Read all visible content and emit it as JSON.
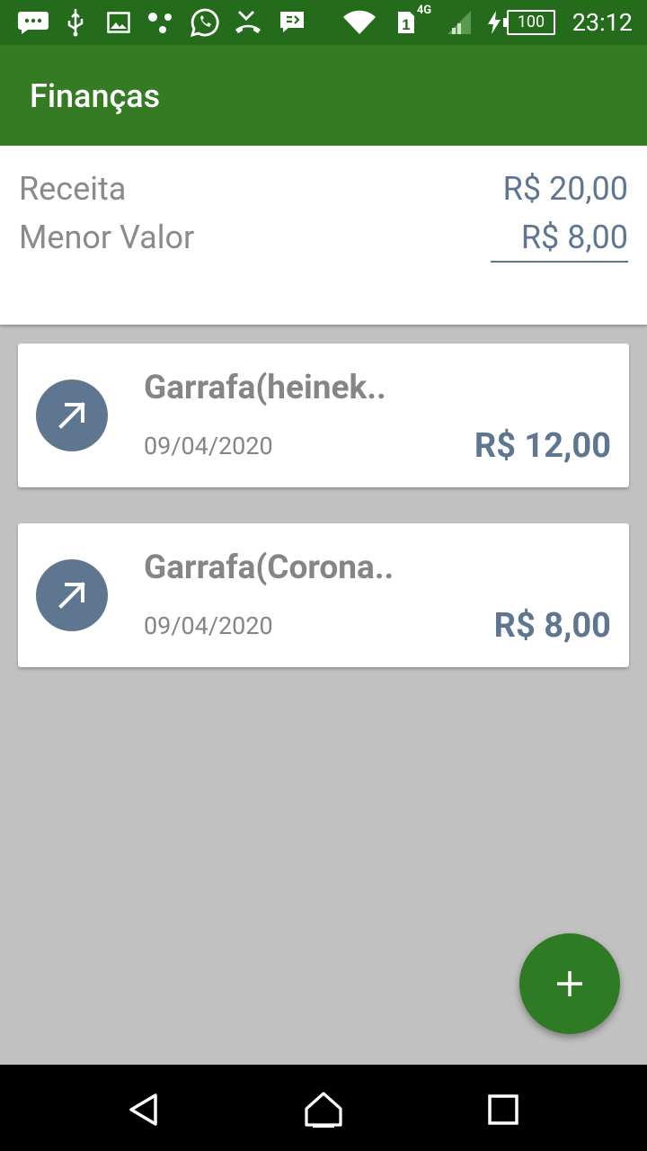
{
  "status_bar": {
    "time": "23:12",
    "battery_level": "100",
    "sim_slot": "1",
    "network_type": "4G",
    "icons": [
      "messages-icon",
      "usb-icon",
      "image-icon",
      "dots-icon",
      "whatsapp-icon",
      "missed-call-icon",
      "chat-icon",
      "wifi-icon",
      "sim-icon",
      "signal-icon",
      "charging-icon",
      "battery-icon"
    ]
  },
  "app_bar": {
    "title": "Finanças"
  },
  "summary": {
    "revenue_label": "Receita",
    "revenue_value": "R$ 20,00",
    "lowest_label": "Menor Valor",
    "lowest_value": "R$ 8,00"
  },
  "transactions": [
    {
      "title": "Garrafa(heinek..",
      "date": "09/04/2020",
      "amount": "R$ 12,00",
      "icon": "arrow-up-right-icon"
    },
    {
      "title": "Garrafa(Corona..",
      "date": "09/04/2020",
      "amount": "R$ 8,00",
      "icon": "arrow-up-right-icon"
    }
  ],
  "fab": {
    "icon": "plus-icon"
  },
  "colors": {
    "status_bar": "#246b1c",
    "app_bar": "#347b23",
    "accent": "#5f7691",
    "fab": "#2f7a24",
    "background": "#c1c1c1"
  }
}
